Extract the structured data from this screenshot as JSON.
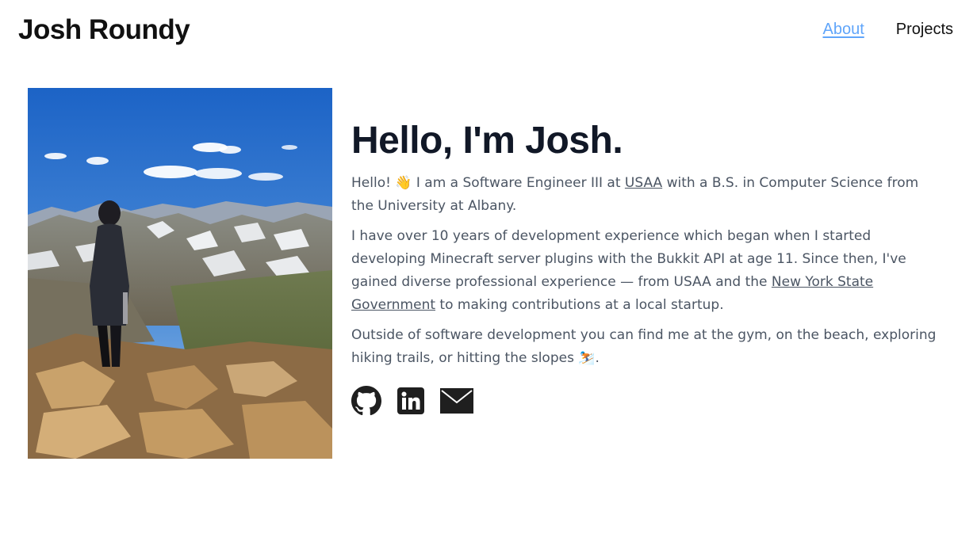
{
  "header": {
    "title": "Josh Roundy",
    "nav": [
      {
        "label": "About",
        "active": true
      },
      {
        "label": "Projects",
        "active": false
      }
    ]
  },
  "main": {
    "headline": "Hello, I'm Josh.",
    "p1": {
      "before": "Hello! 👋 I am a Software Engineer III at ",
      "link": "USAA",
      "after": " with a B.S. in Computer Science from the University at Albany."
    },
    "p2": {
      "before": "I have over 10 years of development experience which began when I started developing Minecraft server plugins with the Bukkit API at age 11. Since then, I've gained diverse professional experience — from USAA and the ",
      "link": "New York State Government",
      "after": " to making contributions at a local startup."
    },
    "p3": "Outside of software development you can find me at the gym, on the beach, exploring hiking trails, or hitting the slopes ⛷️.",
    "socials": [
      "github-icon",
      "linkedin-icon",
      "mail-icon"
    ]
  },
  "colors": {
    "accent": "#60a5fa",
    "heading": "#111827",
    "body": "#4b5563"
  }
}
